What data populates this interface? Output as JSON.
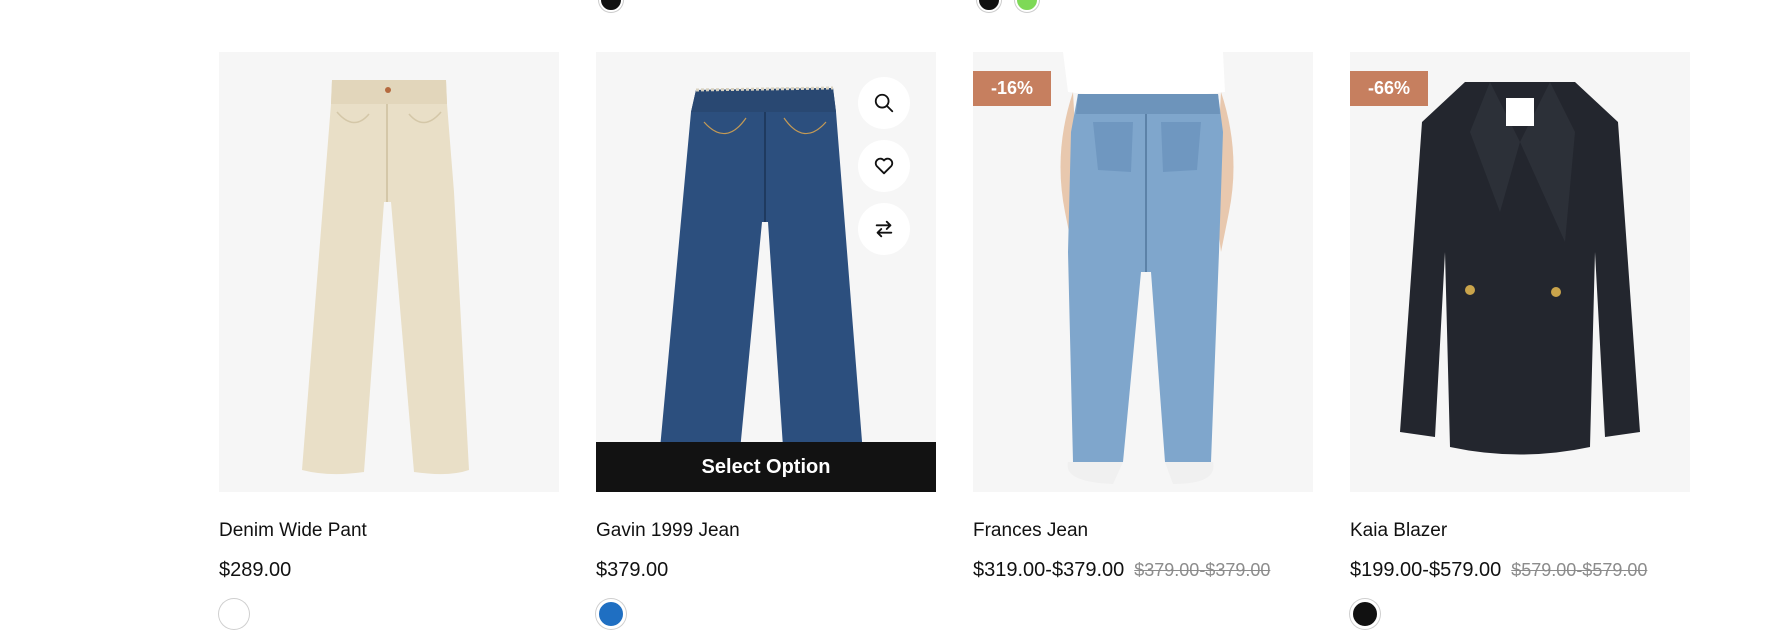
{
  "top_swatches": [
    {
      "color": "#111111"
    },
    {
      "color": "#111111"
    },
    {
      "color": "#7ed957"
    }
  ],
  "products": [
    {
      "title": "Denim Wide Pant",
      "price": "$289.00",
      "old_price": "",
      "badge": "",
      "image": "cream-wide-leg-pants",
      "swatches": [
        {
          "color": "#ffffff"
        }
      ]
    },
    {
      "title": "Gavin 1999 Jean",
      "price": "$379.00",
      "old_price": "",
      "badge": "",
      "image": "dark-blue-straight-jeans",
      "select_option_label": "Select Option",
      "actions": [
        "search-icon",
        "heart-icon",
        "compare-icon"
      ],
      "swatches": [
        {
          "color": "#1f6fc2"
        }
      ]
    },
    {
      "title": "Frances Jean",
      "price": "$319.00-$379.00",
      "old_price": "$379.00-$379.00",
      "badge": "-16%",
      "image": "light-blue-jeans-model-back",
      "swatches": []
    },
    {
      "title": "Kaia Blazer",
      "price": "$199.00-$579.00",
      "old_price": "$579.00-$579.00",
      "badge": "-66%",
      "image": "navy-double-breasted-blazer",
      "swatches": [
        {
          "color": "#111111"
        }
      ]
    }
  ]
}
